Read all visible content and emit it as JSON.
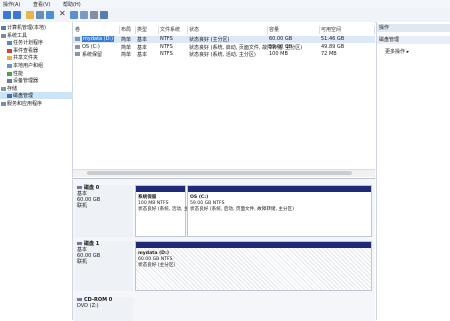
{
  "menu": [
    "操作(A)",
    "查看(V)",
    "帮助(H)"
  ],
  "toolbar": {
    "icons": [
      "back-icon",
      "forward-icon",
      "up-icon",
      "properties-icon",
      "help-icon",
      "delete-icon",
      "export-icon",
      "settings-icon",
      "list-icon",
      "help-book-icon"
    ]
  },
  "tree": {
    "items": [
      {
        "label": "计算机管理(本地)",
        "icon": "computer-icon",
        "indent": 0
      },
      {
        "label": "系统工具",
        "icon": "tools-icon",
        "indent": 0
      },
      {
        "label": "任务计划程序",
        "icon": "clock-icon",
        "indent": 1
      },
      {
        "label": "事件查看器",
        "icon": "event-icon",
        "indent": 1
      },
      {
        "label": "共享文件夹",
        "icon": "folder-icon",
        "indent": 1
      },
      {
        "label": "本地用户和组",
        "icon": "users-icon",
        "indent": 1
      },
      {
        "label": "性能",
        "icon": "performance-icon",
        "indent": 1
      },
      {
        "label": "设备管理器",
        "icon": "device-icon",
        "indent": 1
      },
      {
        "label": "存储",
        "icon": "storage-icon",
        "indent": 0
      },
      {
        "label": "磁盘管理",
        "icon": "disk-icon",
        "indent": 1,
        "selected": true
      },
      {
        "label": "服务和应用程序",
        "icon": "services-icon",
        "indent": 0
      }
    ]
  },
  "volumes": {
    "headers": [
      "卷",
      "布局",
      "类型",
      "文件系统",
      "状态",
      "容量",
      "可用空间"
    ],
    "rows": [
      {
        "cells": [
          "mydata (D:)",
          "简单",
          "基本",
          "NTFS",
          "状态良好 (主分区)",
          "60.00 GB",
          "51.46 GB"
        ],
        "selected": true
      },
      {
        "cells": [
          "OS (C:)",
          "简单",
          "基本",
          "NTFS",
          "状态良好 (系统, 启动, 页面文件, 故障转储, 主分区)",
          "59.00 GB",
          "49.89 GB"
        ]
      },
      {
        "cells": [
          "系统保留",
          "简单",
          "基本",
          "NTFS",
          "状态良好 (系统, 活动, 主分区)",
          "100 MB",
          "72 MB"
        ]
      }
    ]
  },
  "disks": [
    {
      "name": "磁盘 0",
      "type": "基本",
      "size": "60.00 GB",
      "status": "联机",
      "partitions": [
        {
          "title": "系统保留",
          "line1": "100 MB NTFS",
          "line2": "状态良好 (系统, 活动, 主分区)",
          "share": 0.22
        },
        {
          "title": "OS  (C:)",
          "line1": "59.00 GB NTFS",
          "line2": "状态良好 (系统, 启动, 页面文件, 故障转储, 主分区)",
          "share": 0.78
        }
      ]
    },
    {
      "name": "磁盘 1",
      "type": "基本",
      "size": "60.00 GB",
      "status": "联机",
      "partitions": [
        {
          "title": "mydata  (D:)",
          "line1": "60.00 GB NTFS",
          "line2": "状态良好 (主分区)",
          "share": 1.0,
          "hatched": true
        }
      ]
    },
    {
      "name": "CD-ROM 0",
      "type": "DVD (Z:)",
      "size": "",
      "status": ""
    }
  ],
  "actions": {
    "header": "操作",
    "section": "磁盘管理",
    "more": "更多操作"
  }
}
